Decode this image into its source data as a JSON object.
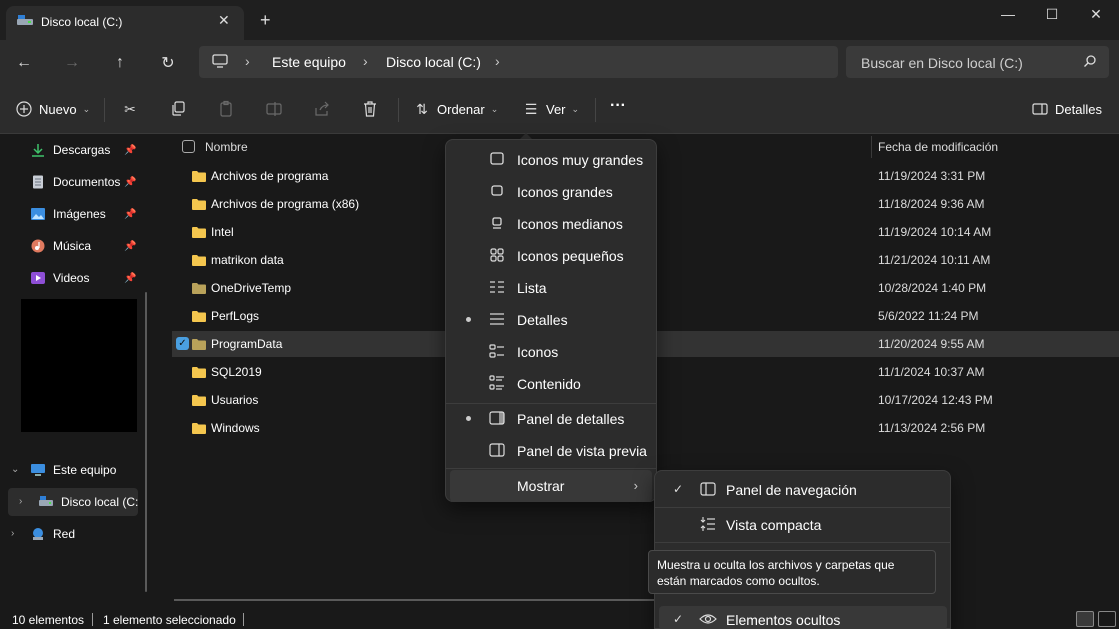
{
  "window": {
    "tab_title": "Disco local (C:)",
    "close_tab": "✕",
    "new_tab": "+",
    "minimize": "—",
    "maximize": "☐",
    "close": "✕"
  },
  "address": {
    "path": [
      "Este equipo",
      "Disco local (C:)"
    ],
    "search_placeholder": "Buscar en Disco local (C:)"
  },
  "toolbar": {
    "new_label": "Nuevo",
    "sort_label": "Ordenar",
    "view_label": "Ver",
    "more_label": "···",
    "details_label": "Detalles"
  },
  "sidebar": {
    "quick_access": [
      {
        "label": "Descargas",
        "icon": "download-icon"
      },
      {
        "label": "Documentos",
        "icon": "document-icon"
      },
      {
        "label": "Imágenes",
        "icon": "image-icon"
      },
      {
        "label": "Música",
        "icon": "music-icon"
      },
      {
        "label": "Videos",
        "icon": "video-icon"
      }
    ],
    "this_pc": "Este equipo",
    "local_disk": "Disco local (C:",
    "network": "Red"
  },
  "list": {
    "columns": {
      "name": "Nombre",
      "date": "Fecha de modificación"
    },
    "rows": [
      {
        "name": "Archivos de programa",
        "date": "11/19/2024 3:31 PM"
      },
      {
        "name": "Archivos de programa (x86)",
        "date": "11/18/2024 9:36 AM"
      },
      {
        "name": "Intel",
        "date": "11/19/2024 10:14 AM"
      },
      {
        "name": "matrikon data",
        "date": "11/21/2024 10:11 AM"
      },
      {
        "name": "OneDriveTemp",
        "date": "10/28/2024 1:40 PM"
      },
      {
        "name": "PerfLogs",
        "date": "5/6/2022 11:24 PM"
      },
      {
        "name": "ProgramData",
        "date": "11/20/2024 9:55 AM"
      },
      {
        "name": "SQL2019",
        "date": "11/1/2024 10:37 AM"
      },
      {
        "name": "Usuarios",
        "date": "10/17/2024 12:43 PM"
      },
      {
        "name": "Windows",
        "date": "11/13/2024 2:56 PM"
      }
    ]
  },
  "status": {
    "count": "10 elementos",
    "selected": "1 elemento seleccionado"
  },
  "view_menu": {
    "items": [
      {
        "label": "Iconos muy grandes"
      },
      {
        "label": "Iconos grandes"
      },
      {
        "label": "Iconos medianos"
      },
      {
        "label": "Iconos pequeños"
      },
      {
        "label": "Lista"
      },
      {
        "label": "Detalles"
      },
      {
        "label": "Iconos"
      },
      {
        "label": "Contenido"
      },
      {
        "label": "Panel de detalles"
      },
      {
        "label": "Panel de vista previa"
      },
      {
        "label": "Mostrar"
      }
    ]
  },
  "show_submenu": {
    "items": [
      {
        "label": "Panel de navegación"
      },
      {
        "label": "Vista compacta"
      },
      {
        "label": "Elementos ocultos"
      }
    ],
    "check": "✓"
  },
  "tooltip": {
    "text": "Muestra u oculta los archivos y carpetas que están marcados como ocultos."
  }
}
